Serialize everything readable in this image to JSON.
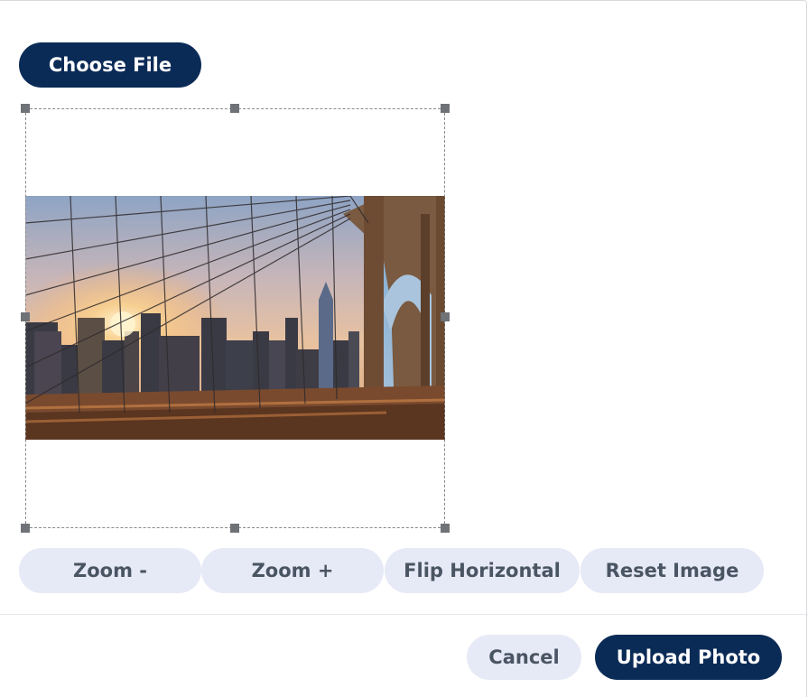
{
  "uploader": {
    "choose_file_label": "Choose File"
  },
  "editor": {
    "photo_description": "Brooklyn Bridge cables with Manhattan skyline at sunset"
  },
  "controls": {
    "zoom_out_label": "Zoom -",
    "zoom_in_label": "Zoom +",
    "flip_label": "Flip Horizontal",
    "reset_label": "Reset Image"
  },
  "footer": {
    "cancel_label": "Cancel",
    "upload_label": "Upload Photo"
  },
  "colors": {
    "primary": "#0b2b57",
    "secondary_bg": "#e6e9f6",
    "secondary_text": "#4a5563",
    "handle": "#6f7277"
  }
}
